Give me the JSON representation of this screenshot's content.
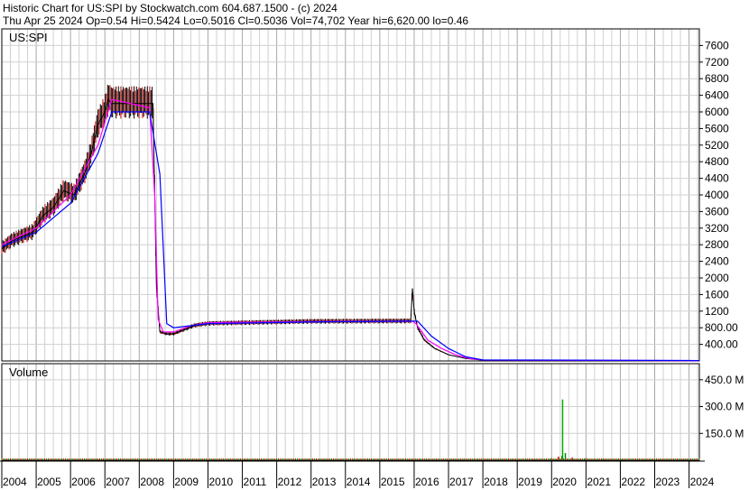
{
  "header": {
    "line1": "Historic Chart for US:SPI by Stockwatch.com 604.687.1500 - (c) 2024",
    "line2": "Thu Apr 25 2024   Op=0.54   Hi=0.5424   Lo=0.5016   Cl=0.5036   Vol=74,702   Year hi=6,620.00   lo=0.46"
  },
  "chart_data": {
    "type": "line",
    "symbol_label": "US:SPI",
    "volume_label": "Volume",
    "price_axis": {
      "ylim": [
        0,
        8000
      ],
      "ticks": [
        400,
        800,
        1200,
        1600,
        2000,
        2400,
        2800,
        3200,
        3600,
        4000,
        4400,
        4800,
        5200,
        5600,
        6000,
        6400,
        6800,
        7200,
        7600
      ],
      "tick_labels": [
        "400.00",
        "800.00",
        "1200",
        "1600",
        "2000",
        "2400",
        "2800",
        "3200",
        "3600",
        "4000",
        "4400",
        "4800",
        "5200",
        "5600",
        "6000",
        "6400",
        "6800",
        "7200",
        "7600"
      ]
    },
    "volume_axis": {
      "ylim": [
        0,
        540
      ],
      "ticks": [
        150,
        300,
        450
      ],
      "tick_labels": [
        "150.0 M",
        "300.0 M",
        "450.0 M"
      ]
    },
    "x_axis": {
      "xlim": [
        2004.0,
        2024.3
      ],
      "years": [
        2004,
        2005,
        2006,
        2007,
        2008,
        2009,
        2010,
        2011,
        2012,
        2013,
        2014,
        2015,
        2016,
        2017,
        2018,
        2019,
        2020,
        2021,
        2022,
        2023,
        2024
      ],
      "year_labels": [
        "2004",
        "2005",
        "2006",
        "2007",
        "2008",
        "2009",
        "2010",
        "2011",
        "2012",
        "2013",
        "2014",
        "2015",
        "2016",
        "2017",
        "2018",
        "2019",
        "2020",
        "2021",
        "2022",
        "2023",
        "2024"
      ]
    },
    "price": {
      "x": [
        2004.0,
        2004.3,
        2004.6,
        2004.9,
        2005.2,
        2005.5,
        2005.8,
        2006.1,
        2006.4,
        2006.6,
        2006.8,
        2007.0,
        2007.1,
        2007.2,
        2008.4,
        2008.5,
        2008.6,
        2008.8,
        2009.0,
        2009.3,
        2009.6,
        2010.0,
        2013.0,
        2015.9,
        2015.95,
        2016.0,
        2016.1,
        2016.3,
        2016.6,
        2017.0,
        2017.5,
        2018.0,
        2020.0,
        2024.3
      ],
      "y": [
        2700,
        2900,
        3000,
        3100,
        3500,
        3700,
        4100,
        4000,
        4500,
        5000,
        5700,
        6000,
        6300,
        6200,
        6200,
        1800,
        700,
        650,
        650,
        750,
        850,
        900,
        950,
        960,
        1750,
        1200,
        800,
        500,
        300,
        150,
        60,
        20,
        10,
        5
      ]
    },
    "series": [
      {
        "name": "",
        "color": "#ff00ff",
        "x": [
          2004.0,
          2005.0,
          2006.0,
          2006.8,
          2007.2,
          2008.3,
          2008.45,
          2008.55,
          2008.7,
          2009.0,
          2009.5,
          2010.0,
          2013.0,
          2015.95,
          2016.05,
          2016.4,
          2016.8,
          2017.2,
          2017.6,
          2018.0,
          2024.3
        ],
        "y": [
          2800,
          3200,
          4000,
          5200,
          6300,
          6100,
          4000,
          1000,
          700,
          700,
          850,
          920,
          950,
          960,
          900,
          500,
          300,
          150,
          60,
          20,
          8
        ]
      },
      {
        "name": "",
        "color": "#0000ff",
        "x": [
          2004.0,
          2005.0,
          2006.0,
          2006.8,
          2007.2,
          2008.3,
          2008.6,
          2008.8,
          2009.0,
          2009.5,
          2010.0,
          2013.0,
          2015.95,
          2016.1,
          2016.5,
          2017.0,
          2017.5,
          2018.0,
          2024.3
        ],
        "y": [
          2750,
          3100,
          3800,
          5000,
          6000,
          6000,
          4500,
          900,
          800,
          850,
          900,
          940,
          960,
          960,
          600,
          300,
          100,
          25,
          10
        ]
      }
    ],
    "volume": {
      "x": [
        2004.0,
        2005.0,
        2006.0,
        2007.0,
        2008.0,
        2009.0,
        2010.0,
        2012.0,
        2014.0,
        2016.0,
        2018.0,
        2019.5,
        2020.0,
        2020.2,
        2020.3,
        2020.32,
        2020.4,
        2020.6,
        2021.0,
        2021.5,
        2022.0,
        2023.0,
        2024.0
      ],
      "values": [
        2,
        2,
        2,
        2,
        3,
        2,
        1,
        1,
        1,
        4,
        3,
        5,
        12,
        20,
        25,
        340,
        40,
        15,
        12,
        8,
        6,
        4,
        3
      ]
    }
  }
}
